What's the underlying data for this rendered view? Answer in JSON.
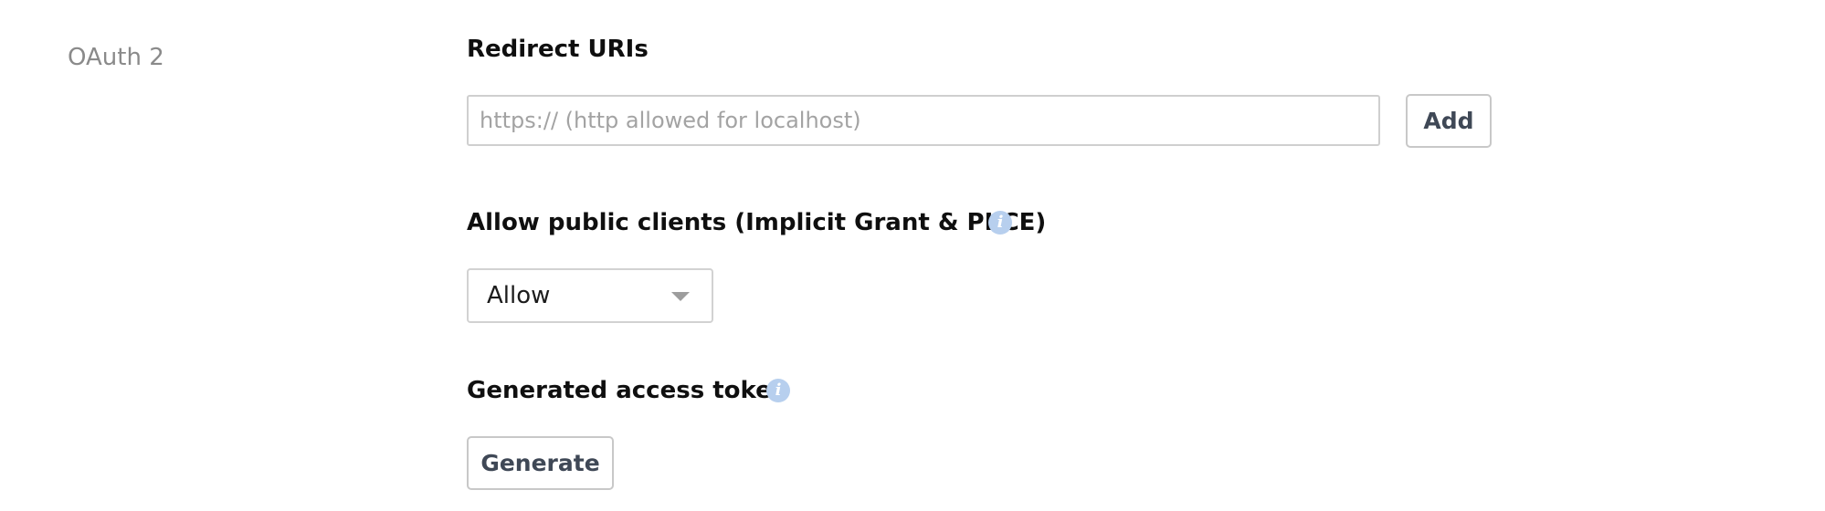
{
  "section": {
    "label": "OAuth 2"
  },
  "redirect_uris": {
    "heading": "Redirect URIs",
    "input_value": "",
    "placeholder": "https:// (http allowed for localhost)",
    "add_label": "Add"
  },
  "public_clients": {
    "heading": "Allow public clients (Implicit Grant & PKCE)",
    "info_icon": "info-icon",
    "selected_option": "Allow"
  },
  "access_token": {
    "heading": "Generated access token",
    "info_icon": "info-icon",
    "generate_label": "Generate"
  },
  "colors": {
    "section_label": "#8a8a8a",
    "info_icon_bg": "#b7cfee",
    "button_text": "#3f4856",
    "border": "#cfcfcf"
  }
}
